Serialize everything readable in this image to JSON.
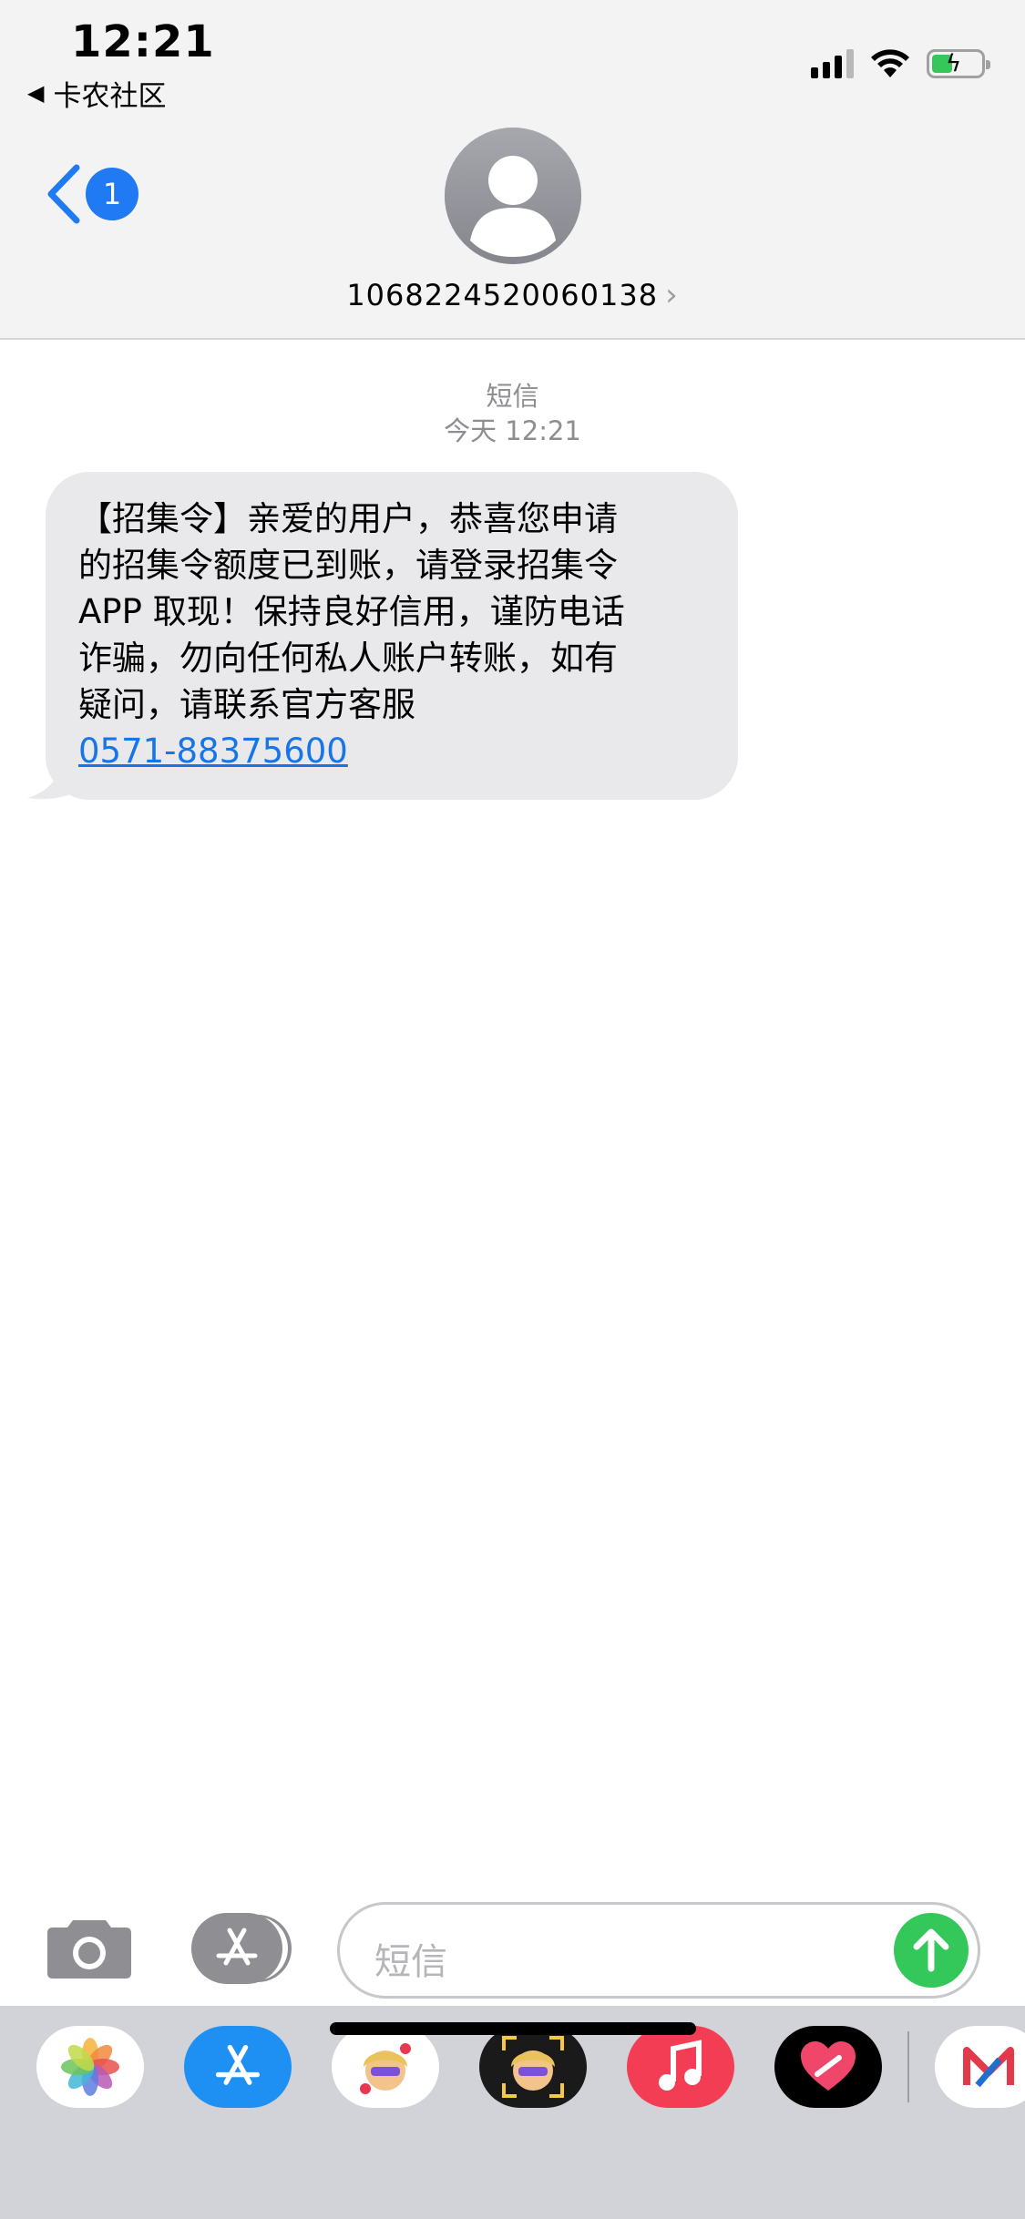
{
  "status_bar": {
    "time": "12:21",
    "back_app_label": "卡农社区",
    "signal_bars": 3,
    "battery_charging": true
  },
  "nav": {
    "back_badge_count": "1",
    "contact_number": "1068224520060138"
  },
  "conversation": {
    "message_type": "短信",
    "timestamp": "今天 12:21",
    "message": {
      "lines": [
        "【招集令】亲爱的用户，恭喜您申请",
        "的招集令额度已到账，请登录招集令",
        "APP 取现！保持良好信用，谨防电话",
        "诈骗，勿向任何私人账户转账，如有",
        "疑问，请联系官方客服"
      ],
      "phone_link": "0571-88375600"
    }
  },
  "compose": {
    "placeholder": "短信"
  },
  "app_drawer": {
    "apps": [
      "photos-icon",
      "app-store-icon",
      "memoji-stickers-icon",
      "animoji-icon",
      "music-icon",
      "digital-touch-icon",
      "more-app-icon"
    ]
  },
  "colors": {
    "accent_blue": "#1f7af4",
    "link_blue": "#1875e8",
    "send_green": "#34c759",
    "bubble_gray": "#e9e9eb",
    "drawer_gray": "#d1d3d9"
  }
}
